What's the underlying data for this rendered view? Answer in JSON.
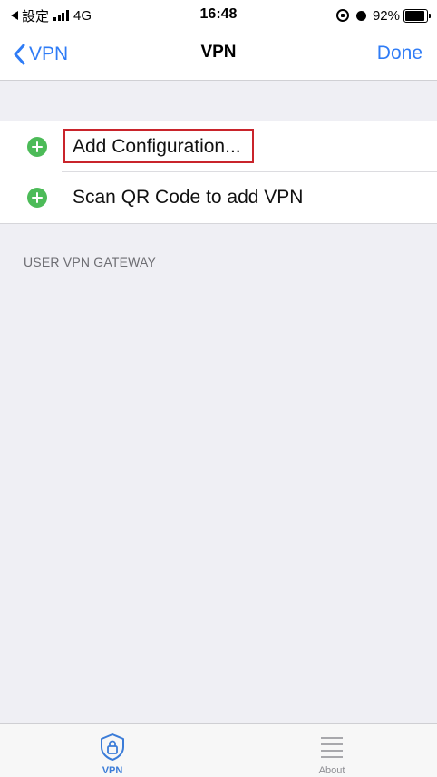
{
  "status_bar": {
    "back_app": "設定",
    "network": "4G",
    "time": "16:48",
    "battery_percent": "92%",
    "battery_level": 0.92
  },
  "nav": {
    "back_label": "VPN",
    "title": "VPN",
    "done_label": "Done"
  },
  "list": {
    "items": [
      {
        "label": "Add Configuration...",
        "icon": "plus-circle-icon",
        "highlighted": true
      },
      {
        "label": "Scan QR Code to add VPN",
        "icon": "plus-circle-icon",
        "highlighted": false
      }
    ]
  },
  "section": {
    "header": "USER VPN GATEWAY"
  },
  "tab_bar": {
    "tabs": [
      {
        "label": "VPN",
        "icon": "shield-lock-icon",
        "selected": true
      },
      {
        "label": "About",
        "icon": "list-icon",
        "selected": false
      }
    ]
  },
  "colors": {
    "accent": "#2f7cf6",
    "add_icon": "#4cbb58",
    "highlight_border": "#c9242b",
    "background": "#efeff4"
  }
}
